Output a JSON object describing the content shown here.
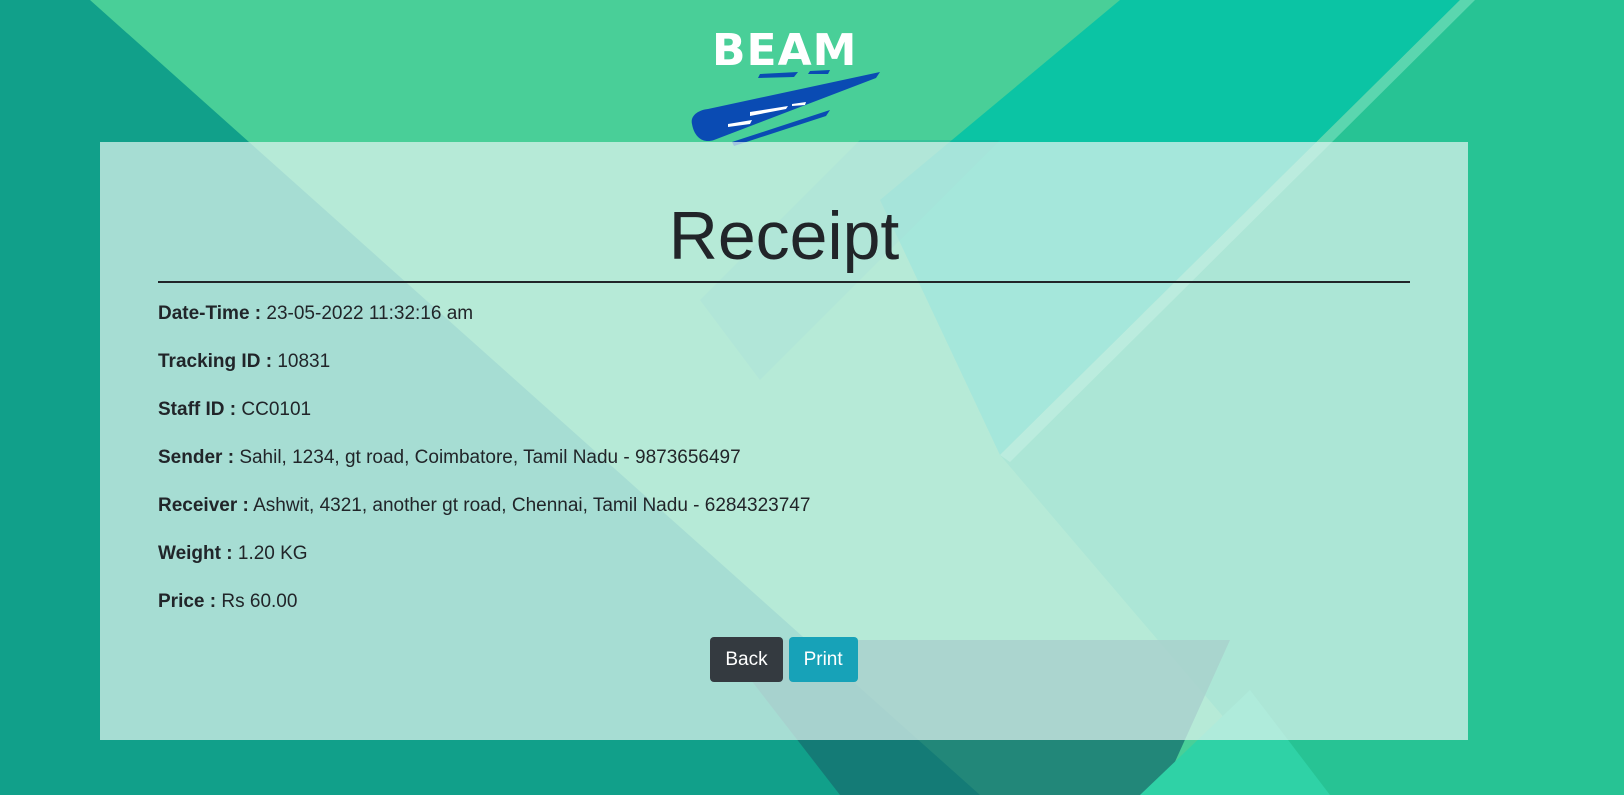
{
  "brand": {
    "name": "BEAM",
    "logo_mark": "comet-swoosh-icon"
  },
  "receipt": {
    "title": "Receipt",
    "fields": [
      {
        "label": "Date-Time :",
        "value": "23-05-2022 11:32:16 am"
      },
      {
        "label": "Tracking ID :",
        "value": "10831"
      },
      {
        "label": "Staff ID :",
        "value": "CC0101"
      },
      {
        "label": "Sender :",
        "value": "Sahil, 1234, gt road, Coimbatore, Tamil Nadu - 9873656497"
      },
      {
        "label": "Receiver :",
        "value": "Ashwit, 4321, another gt road, Chennai, Tamil Nadu - 6284323747"
      },
      {
        "label": "Weight :",
        "value": "1.20 KG"
      },
      {
        "label": "Price :",
        "value": "Rs 60.00"
      }
    ]
  },
  "actions": {
    "back_label": "Back",
    "print_label": "Print"
  },
  "colors": {
    "back_button": "#343a40",
    "print_button": "#17a2b8",
    "logo_mark": "#0a4bb3"
  }
}
